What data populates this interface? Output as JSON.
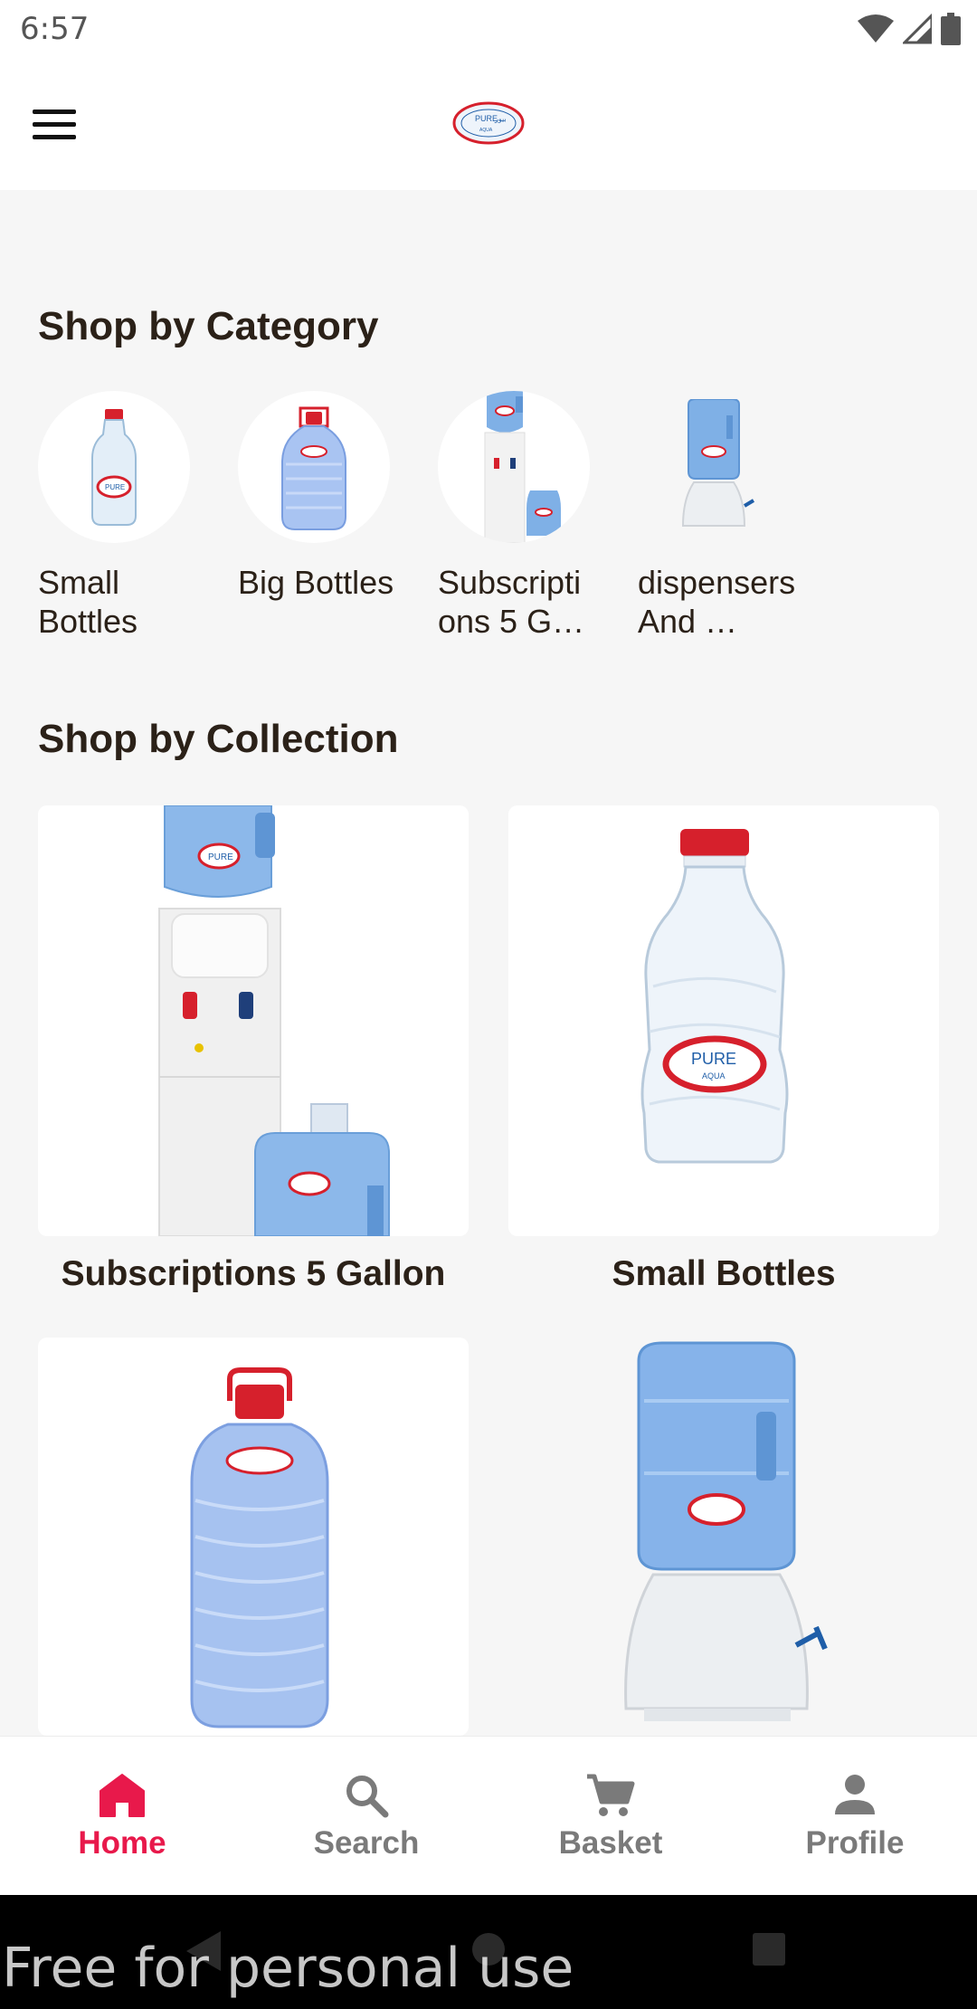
{
  "status_bar": {
    "time": "6:57",
    "icons": [
      "wifi-icon",
      "signal-icon",
      "battery-icon"
    ]
  },
  "header": {
    "menu_icon": "hamburger-menu-icon",
    "logo_text": "PURE"
  },
  "categories": {
    "title": "Shop by Category",
    "items": [
      {
        "label": "Small Bottles",
        "icon": "small-bottle-image"
      },
      {
        "label": "Big Bottles",
        "icon": "big-bottle-image"
      },
      {
        "label": "Subscriptions 5 G…",
        "icon": "water-cooler-image"
      },
      {
        "label": "dispensers And …",
        "icon": "dispenser-image"
      }
    ]
  },
  "collections": {
    "title": "Shop by Collection",
    "items": [
      {
        "label": "Subscriptions 5 Gallon"
      },
      {
        "label": "Small Bottles"
      },
      {
        "label": ""
      },
      {
        "label": ""
      }
    ]
  },
  "bottom_nav": {
    "items": [
      {
        "label": "Home",
        "icon": "home-icon",
        "active": true
      },
      {
        "label": "Search",
        "icon": "search-icon",
        "active": false
      },
      {
        "label": "Basket",
        "icon": "cart-icon",
        "active": false
      },
      {
        "label": "Profile",
        "icon": "person-icon",
        "active": false
      }
    ]
  },
  "watermark": "Free for personal use",
  "colors": {
    "accent": "#e8194b",
    "text": "#2b2118",
    "background": "#f6f6f6",
    "inactive": "#7a7a7a"
  }
}
